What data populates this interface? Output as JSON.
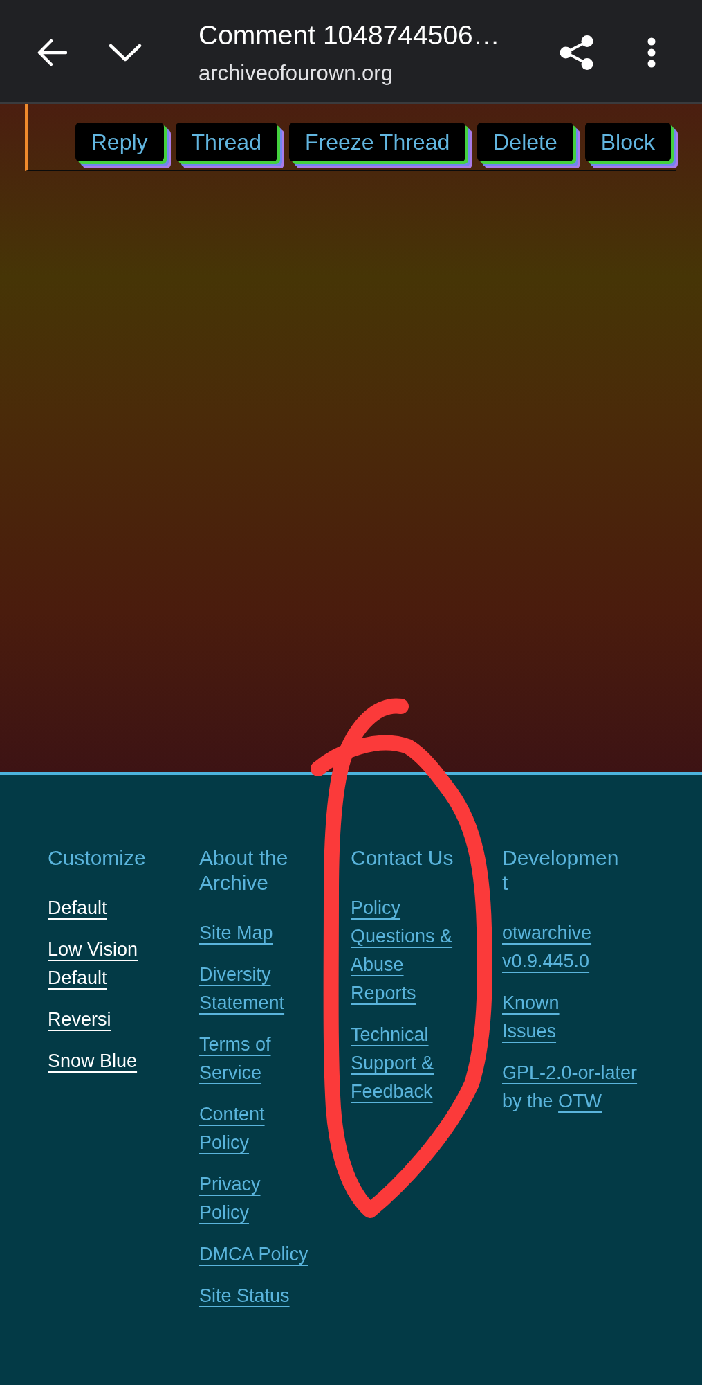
{
  "browser_bar": {
    "title": "Comment 1048744506…",
    "url": "archiveofourown.org"
  },
  "comment_actions": [
    {
      "label": "Reply"
    },
    {
      "label": "Thread"
    },
    {
      "label": "Freeze Thread"
    },
    {
      "label": "Delete"
    },
    {
      "label": "Block"
    }
  ],
  "footer": {
    "columns": [
      {
        "heading": "Customize",
        "items": [
          {
            "kind": "button",
            "text": "Default"
          },
          {
            "kind": "button",
            "text": "Low Vision Default"
          },
          {
            "kind": "button",
            "text": "Reversi"
          },
          {
            "kind": "button",
            "text": "Snow Blue"
          }
        ]
      },
      {
        "heading": "About the Archive",
        "items": [
          {
            "kind": "link",
            "text": "Site Map"
          },
          {
            "kind": "link",
            "text": "Diversity Statement"
          },
          {
            "kind": "link",
            "text": "Terms of Service"
          },
          {
            "kind": "link",
            "text": "Content Policy"
          },
          {
            "kind": "link",
            "text": "Privacy Policy"
          },
          {
            "kind": "link",
            "text": "DMCA Policy"
          },
          {
            "kind": "link",
            "text": "Site Status"
          }
        ]
      },
      {
        "heading": "Contact Us",
        "items": [
          {
            "kind": "link",
            "text": "Policy Questions & Abuse Reports"
          },
          {
            "kind": "link",
            "text": "Technical Support & Feedback"
          }
        ]
      },
      {
        "heading": "Development",
        "items": [
          {
            "kind": "link",
            "text": "otwarchive v0.9.445.0"
          },
          {
            "kind": "link",
            "text": "Known Issues"
          },
          {
            "kind": "sentence",
            "parts": [
              {
                "kind": "link",
                "text": "GPL-2.0-or-later"
              },
              {
                "kind": "text",
                "text": "by the"
              },
              {
                "kind": "link",
                "text": "OTW"
              }
            ]
          }
        ]
      }
    ]
  }
}
